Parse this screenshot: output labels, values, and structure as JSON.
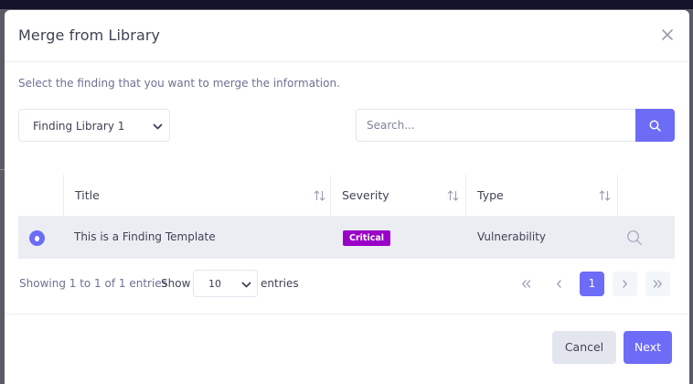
{
  "modal": {
    "title": "Merge from Library",
    "instruction": "Select the finding that you want to merge the information."
  },
  "library_select": {
    "selected": "Finding Library 1"
  },
  "search": {
    "placeholder": "Search...",
    "value": ""
  },
  "table": {
    "columns": [
      "Title",
      "Severity",
      "Type"
    ],
    "rows": [
      {
        "title": "This is a Finding Template",
        "severity": "Critical",
        "type": "Vulnerability",
        "selected": true
      }
    ]
  },
  "footer_info": {
    "showing": "Showing 1 to 1 of 1 entries",
    "show_label": "Show",
    "page_size": "10",
    "entries_label": "entries"
  },
  "pagination": {
    "current_page": "1"
  },
  "buttons": {
    "cancel": "Cancel",
    "next": "Next"
  },
  "colors": {
    "accent": "#6c6cf7",
    "critical_badge": "#9a00c8",
    "selected_row": "#ebedf3"
  },
  "icons": {
    "close": "close-icon",
    "chevron": "chevron-down-icon",
    "search": "search-icon",
    "sort": "sort-icon",
    "first": "double-chevron-left-icon",
    "prev": "chevron-left-icon",
    "next": "chevron-right-icon",
    "last": "double-chevron-right-icon"
  }
}
